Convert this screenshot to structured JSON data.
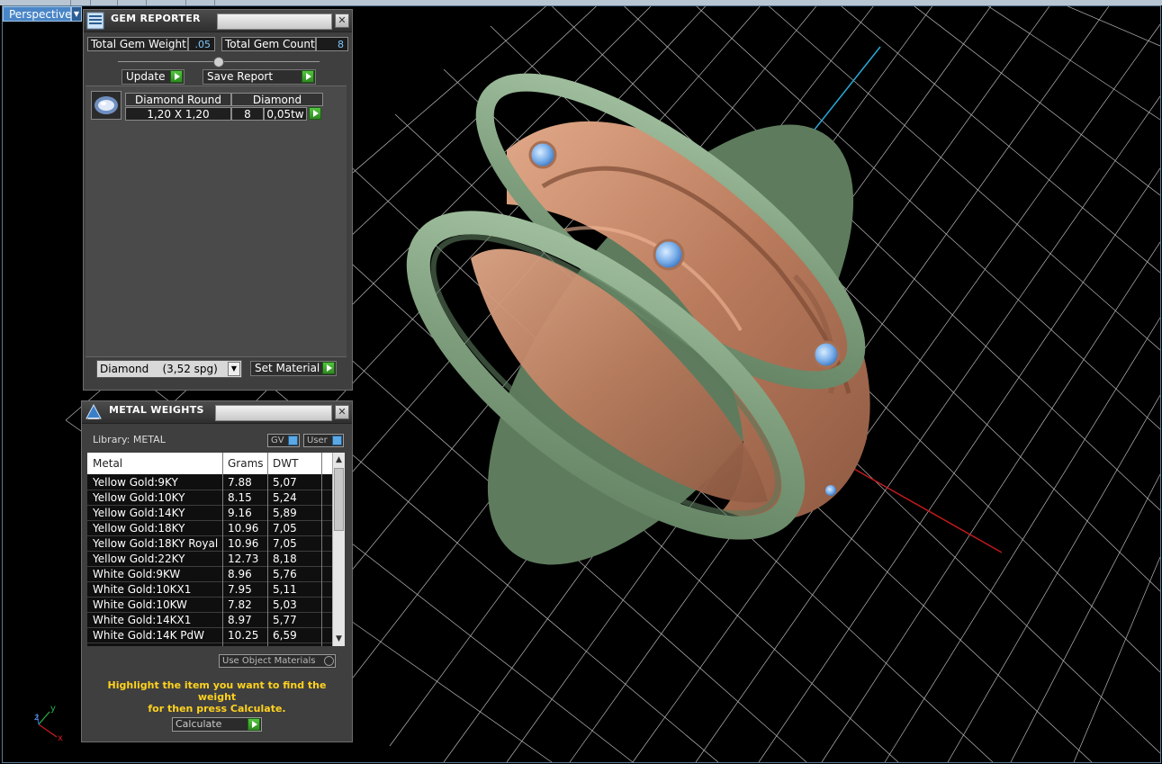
{
  "viewport": {
    "mode_label": "Perspective"
  },
  "gem_reporter": {
    "title": "GEM REPORTER",
    "total_weight_label": "Total Gem Weight",
    "total_weight_value": ".05",
    "total_count_label": "Total Gem Count",
    "total_count_value": "8",
    "update_label": "Update",
    "save_report_label": "Save Report",
    "table": {
      "col1": "Diamond Round",
      "col2": "Diamond",
      "size": "1,20 X 1,20",
      "count": "8",
      "weight": "0,05tw"
    },
    "material_select": "Diamond    (3,52 spg)",
    "set_material_label": "Set Material"
  },
  "metal_weights": {
    "title": "METAL WEIGHTS",
    "library_label": "Library: METAL",
    "gv_label": "GV",
    "user_label": "User",
    "columns": [
      "Metal",
      "Grams",
      "DWT"
    ],
    "rows": [
      {
        "metal": "Yellow Gold:9KY",
        "grams": "7.88",
        "dwt": "5,07"
      },
      {
        "metal": "Yellow Gold:10KY",
        "grams": "8.15",
        "dwt": "5,24"
      },
      {
        "metal": "Yellow Gold:14KY",
        "grams": "9.16",
        "dwt": "5,89"
      },
      {
        "metal": "Yellow Gold:18KY",
        "grams": "10.96",
        "dwt": "7,05"
      },
      {
        "metal": "Yellow Gold:18KY Royal",
        "grams": "10.96",
        "dwt": "7,05"
      },
      {
        "metal": "Yellow Gold:22KY",
        "grams": "12.73",
        "dwt": "8,18"
      },
      {
        "metal": "White Gold:9KW",
        "grams": "8.96",
        "dwt": "5,76"
      },
      {
        "metal": "White Gold:10KX1",
        "grams": "7.95",
        "dwt": "5,11"
      },
      {
        "metal": "White Gold:10KW",
        "grams": "7.82",
        "dwt": "5,03"
      },
      {
        "metal": "White Gold:14KX1",
        "grams": "8.97",
        "dwt": "5,77"
      },
      {
        "metal": "White Gold:14K PdW",
        "grams": "10.25",
        "dwt": "6,59"
      }
    ],
    "use_object_materials_label": "Use Object Materials",
    "hint_line1": "Highlight the item you want to find the weight",
    "hint_line2": "for then press Calculate.",
    "calculate_label": "Calculate"
  },
  "axis_indicator": {
    "x": "x",
    "y": "y",
    "z": "z"
  },
  "colors": {
    "ring_band": "#8fad8f",
    "filigree": "#c0876a",
    "gem": "#7fb2ee",
    "grid": "#ffffff",
    "axis_y": "#29a9d8",
    "axis_x": "#c11a1a",
    "accent_green": "#3fae2f",
    "hint_yellow": "#ffd21f"
  }
}
